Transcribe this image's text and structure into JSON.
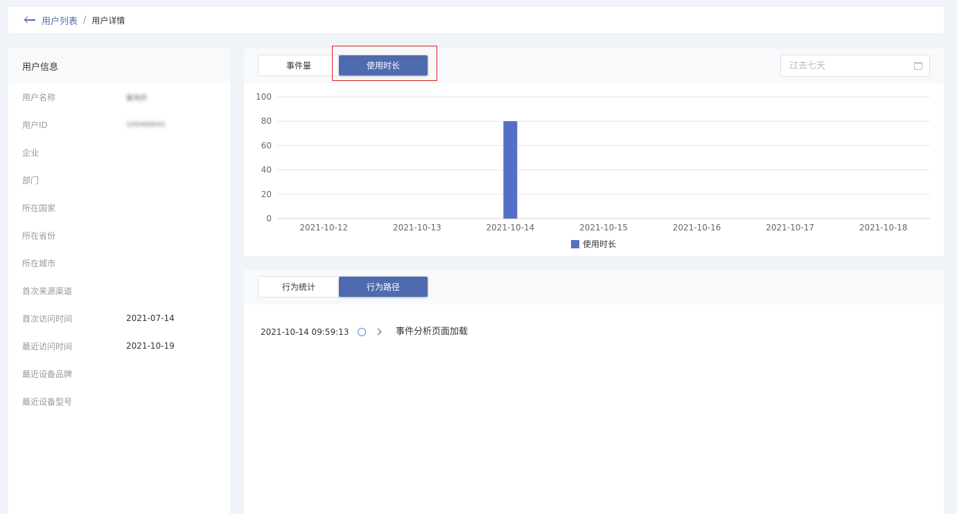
{
  "breadcrumb": {
    "parent": "用户列表",
    "separator": "/",
    "current": "用户详情"
  },
  "user_info": {
    "title": "用户信息",
    "rows": [
      {
        "label": "用户名称",
        "value": "崔伟庆",
        "blurred": true
      },
      {
        "label": "用户ID",
        "value": "105499041",
        "blurred": true
      },
      {
        "label": "企业",
        "value": ""
      },
      {
        "label": "部门",
        "value": ""
      },
      {
        "label": "所在国家",
        "value": ""
      },
      {
        "label": "所在省份",
        "value": ""
      },
      {
        "label": "所在城市",
        "value": ""
      },
      {
        "label": "首次来源渠道",
        "value": ""
      },
      {
        "label": "首次访问时间",
        "value": "2021-07-14"
      },
      {
        "label": "最近访问时间",
        "value": "2021-10-19"
      },
      {
        "label": "最近设备品牌",
        "value": ""
      },
      {
        "label": "最近设备型号",
        "value": ""
      }
    ]
  },
  "chart_card": {
    "tabs": [
      {
        "label": "事件量",
        "active": false
      },
      {
        "label": "使用时长",
        "active": true
      }
    ],
    "date_placeholder": "过去七天"
  },
  "chart_data": {
    "type": "bar",
    "categories": [
      "2021-10-12",
      "2021-10-13",
      "2021-10-14",
      "2021-10-15",
      "2021-10-16",
      "2021-10-17",
      "2021-10-18"
    ],
    "series": [
      {
        "name": "使用时长",
        "values": [
          0,
          0,
          80,
          0,
          0,
          0,
          0
        ],
        "color": "#5470c6"
      }
    ],
    "ylim": [
      0,
      100
    ],
    "yticks": [
      0,
      20,
      40,
      60,
      80,
      100
    ],
    "grid": true,
    "legend": "bottom-center"
  },
  "behavior_card": {
    "tabs": [
      {
        "label": "行为统计",
        "active": false
      },
      {
        "label": "行为路径",
        "active": true
      }
    ],
    "path": [
      {
        "time": "2021-10-14 09:59:13",
        "event": "事件分析页面加载"
      }
    ]
  },
  "colors": {
    "accent": "#4f6baf",
    "bar": "#5470c6",
    "highlight": "#e02020"
  }
}
